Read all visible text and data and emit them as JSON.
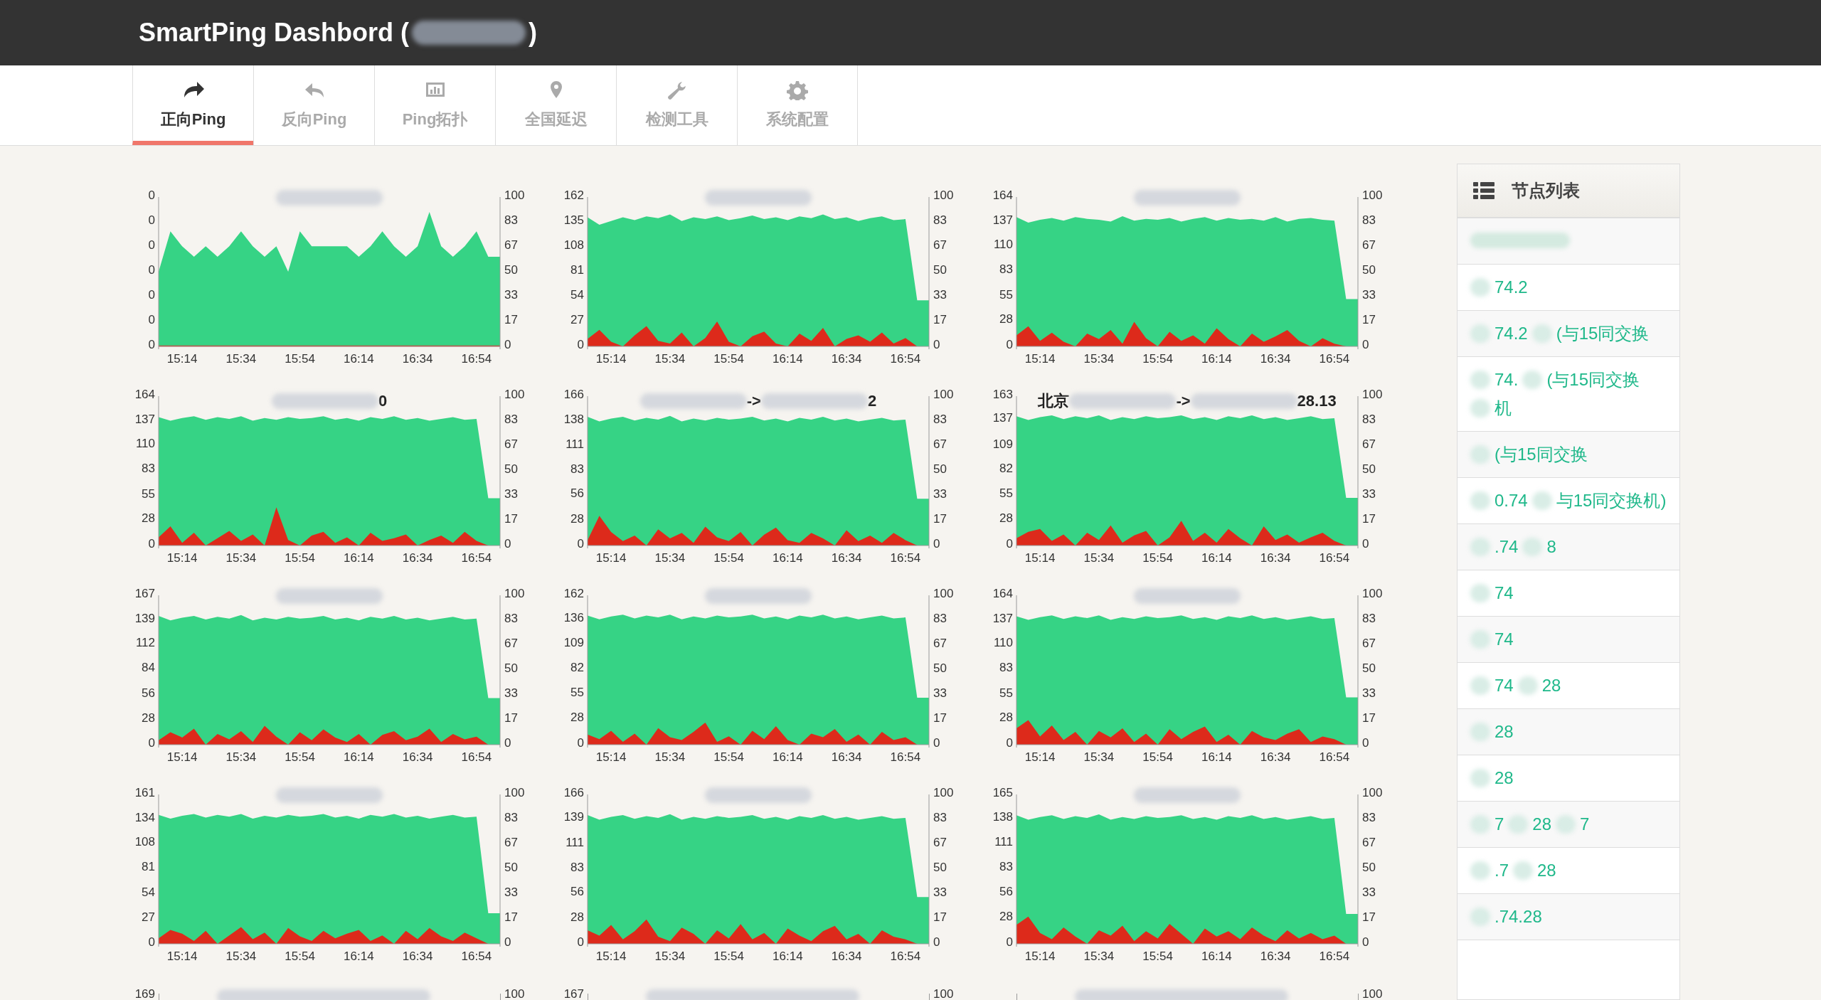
{
  "header": {
    "title_parts": [
      "SmartPing Dashbord (",
      ")"
    ]
  },
  "tabs": [
    {
      "label": "正向Ping",
      "selected": true
    },
    {
      "label": "反向Ping",
      "selected": false
    },
    {
      "label": "Ping拓扑",
      "selected": false
    },
    {
      "label": "全国延迟",
      "selected": false
    },
    {
      "label": "检测工具",
      "selected": false
    },
    {
      "label": "系统配置",
      "selected": false
    }
  ],
  "charts": [
    {
      "title_parts": [
        {
          "kind": "blur"
        }
      ],
      "left_tick_labels": [
        "0",
        "0",
        "0",
        "0",
        "0",
        "0",
        "0"
      ],
      "right_tick_labels": [
        "100",
        "83",
        "67",
        "50",
        "33",
        "17",
        "0"
      ],
      "x_tick_labels": [
        "15:14",
        "15:34",
        "15:54",
        "16:14",
        "16:34",
        "16:54"
      ]
    },
    {
      "title_parts": [
        {
          "kind": "blur"
        }
      ],
      "right_tick_labels": [
        "100",
        "83",
        "67",
        "50",
        "33",
        "17",
        "0"
      ],
      "chart_data": {
        "type": "area",
        "categories": [
          null,
          null,
          "15:14",
          null,
          null,
          null,
          null,
          "15:34",
          null,
          null,
          null,
          null,
          "15:54",
          null,
          null,
          null,
          null,
          "16:14",
          null,
          null,
          null,
          null,
          "16:34",
          null,
          null,
          null,
          null,
          "16:54",
          null,
          null
        ],
        "ylim": [
          0,
          162
        ],
        "yticks": [
          0,
          27,
          54,
          81,
          108,
          135,
          162
        ],
        "series": [
          {
            "color": "#36d385",
            "values": [
              140,
              132,
              136,
              140,
              137,
              141,
              139,
              143,
              136,
              140,
              138,
              141,
              137,
              139,
              142,
              138,
              140,
              137,
              141,
              139,
              143,
              138,
              140,
              136,
              139,
              141,
              137,
              138,
              50,
              50
            ]
          },
          {
            "color": "#dd2a1b",
            "values": [
              8,
              18,
              5,
              0,
              12,
              22,
              6,
              3,
              15,
              0,
              9,
              27,
              5,
              0,
              11,
              16,
              3,
              0,
              14,
              6,
              20,
              0,
              8,
              12,
              5,
              15,
              3,
              9,
              0,
              0
            ]
          }
        ]
      }
    },
    {
      "title_parts": [
        {
          "kind": "blur"
        }
      ],
      "right_tick_labels": [
        "100",
        "83",
        "67",
        "50",
        "33",
        "17",
        "0"
      ],
      "chart_data": {
        "type": "area",
        "categories": [
          null,
          null,
          "15:14",
          null,
          null,
          null,
          null,
          "15:34",
          null,
          null,
          null,
          null,
          "15:54",
          null,
          null,
          null,
          null,
          "16:14",
          null,
          null,
          null,
          null,
          "16:34",
          null,
          null,
          null,
          null,
          "16:54",
          null,
          null
        ],
        "ylim": [
          0,
          164
        ],
        "yticks": [
          0,
          28,
          55,
          83,
          110,
          137,
          164
        ],
        "series": [
          {
            "color": "#36d385",
            "values": [
              142,
              136,
              139,
              141,
              138,
              142,
              140,
              139,
              137,
              143,
              138,
              140,
              139,
              141,
              137,
              140,
              142,
              138,
              141,
              139,
              140,
              138,
              142,
              137,
              140,
              141,
              139,
              138,
              52,
              52
            ]
          },
          {
            "color": "#dd2a1b",
            "values": [
              12,
              22,
              6,
              15,
              5,
              0,
              14,
              8,
              18,
              3,
              27,
              9,
              0,
              16,
              6,
              12,
              3,
              20,
              8,
              0,
              14,
              5,
              11,
              18,
              6,
              0,
              9,
              3,
              0,
              0
            ]
          }
        ]
      }
    },
    {
      "title_parts": [
        {
          "kind": "blur"
        },
        {
          "kind": "text",
          "text": "0"
        }
      ],
      "right_tick_labels": [
        "100",
        "83",
        "67",
        "50",
        "33",
        "17",
        "0"
      ],
      "chart_data": {
        "type": "area",
        "categories": [
          null,
          null,
          "15:14",
          null,
          null,
          null,
          null,
          "15:34",
          null,
          null,
          null,
          null,
          "15:54",
          null,
          null,
          null,
          null,
          "16:14",
          null,
          null,
          null,
          null,
          "16:34",
          null,
          null,
          null,
          null,
          "16:54",
          null,
          null
        ],
        "ylim": [
          0,
          164
        ],
        "yticks": [
          0,
          28,
          55,
          83,
          110,
          137,
          164
        ],
        "series": [
          {
            "color": "#36d385",
            "values": [
              141,
              137,
              140,
              142,
              138,
              141,
              139,
              142,
              137,
              140,
              138,
              141,
              139,
              140,
              142,
              138,
              140,
              137,
              141,
              139,
              142,
              138,
              140,
              137,
              139,
              141,
              138,
              139,
              52,
              52
            ]
          },
          {
            "color": "#dd2a1b",
            "values": [
              9,
              21,
              3,
              14,
              0,
              8,
              16,
              5,
              12,
              0,
              42,
              6,
              0,
              11,
              15,
              3,
              9,
              0,
              14,
              5,
              8,
              12,
              0,
              6,
              11,
              3,
              15,
              5,
              0,
              0
            ]
          }
        ]
      }
    },
    {
      "title_parts": [
        {
          "kind": "blur"
        },
        {
          "kind": "text",
          "text": "->"
        },
        {
          "kind": "blur"
        },
        {
          "kind": "text",
          "text": "2"
        }
      ],
      "right_tick_labels": [
        "100",
        "83",
        "67",
        "50",
        "33",
        "17",
        "0"
      ],
      "chart_data": {
        "type": "area",
        "categories": [
          null,
          null,
          "15:14",
          null,
          null,
          null,
          null,
          "15:34",
          null,
          null,
          null,
          null,
          "15:54",
          null,
          null,
          null,
          null,
          "16:14",
          null,
          null,
          null,
          null,
          "16:34",
          null,
          null,
          null,
          null,
          "16:54",
          null,
          null
        ],
        "ylim": [
          0,
          166
        ],
        "yticks": [
          0,
          28,
          56,
          83,
          111,
          138,
          166
        ],
        "series": [
          {
            "color": "#36d385",
            "values": [
              143,
              138,
              141,
              143,
              139,
              142,
              140,
              144,
              138,
              141,
              139,
              142,
              140,
              141,
              143,
              139,
              141,
              138,
              142,
              140,
              143,
              139,
              141,
              138,
              140,
              142,
              139,
              140,
              52,
              52
            ]
          },
          {
            "color": "#dd2a1b",
            "values": [
              6,
              33,
              15,
              5,
              11,
              0,
              18,
              8,
              14,
              3,
              21,
              9,
              5,
              15,
              0,
              12,
              20,
              6,
              3,
              14,
              8,
              0,
              17,
              5,
              11,
              3,
              14,
              6,
              0,
              0
            ]
          }
        ]
      }
    },
    {
      "title_parts": [
        {
          "kind": "text",
          "text": "北京"
        },
        {
          "kind": "blur"
        },
        {
          "kind": "text",
          "text": "->"
        },
        {
          "kind": "blur"
        },
        {
          "kind": "text",
          "text": "28.13"
        }
      ],
      "right_tick_labels": [
        "100",
        "83",
        "67",
        "50",
        "33",
        "17",
        "0"
      ],
      "chart_data": {
        "type": "area",
        "categories": [
          null,
          null,
          "15:14",
          null,
          null,
          null,
          null,
          "15:34",
          null,
          null,
          null,
          null,
          "15:54",
          null,
          null,
          null,
          null,
          "16:14",
          null,
          null,
          null,
          null,
          "16:34",
          null,
          null,
          null,
          null,
          "16:54",
          null,
          null
        ],
        "ylim": [
          0,
          163
        ],
        "yticks": [
          0,
          28,
          55,
          82,
          109,
          137,
          163
        ],
        "series": [
          {
            "color": "#36d385",
            "values": [
              141,
              137,
              140,
              142,
              138,
              141,
              139,
              142,
              137,
              140,
              138,
              141,
              139,
              140,
              142,
              138,
              140,
              137,
              141,
              139,
              142,
              138,
              140,
              137,
              139,
              141,
              138,
              139,
              52,
              52
            ]
          },
          {
            "color": "#dd2a1b",
            "values": [
              8,
              15,
              18,
              5,
              12,
              0,
              14,
              6,
              22,
              3,
              11,
              16,
              0,
              9,
              27,
              5,
              14,
              3,
              18,
              8,
              0,
              21,
              6,
              12,
              3,
              9,
              14,
              5,
              0,
              0
            ]
          }
        ]
      }
    },
    {
      "title_parts": [
        {
          "kind": "blur"
        }
      ],
      "right_tick_labels": [
        "100",
        "83",
        "67",
        "50",
        "33",
        "17",
        "0"
      ],
      "chart_data": {
        "type": "area",
        "categories": [
          null,
          null,
          "15:14",
          null,
          null,
          null,
          null,
          "15:34",
          null,
          null,
          null,
          null,
          "15:54",
          null,
          null,
          null,
          null,
          "16:14",
          null,
          null,
          null,
          null,
          "16:34",
          null,
          null,
          null,
          null,
          "16:54",
          null,
          null
        ],
        "ylim": [
          0,
          167
        ],
        "yticks": [
          0,
          28,
          56,
          84,
          112,
          139,
          167
        ],
        "series": [
          {
            "color": "#36d385",
            "values": [
              144,
              139,
              142,
              144,
              140,
              143,
              141,
              145,
              139,
              142,
              140,
              143,
              141,
              142,
              144,
              140,
              142,
              139,
              143,
              141,
              144,
              140,
              142,
              139,
              141,
              143,
              140,
              141,
              52,
              52
            ]
          },
          {
            "color": "#dd2a1b",
            "values": [
              5,
              14,
              8,
              18,
              0,
              12,
              6,
              15,
              3,
              21,
              9,
              0,
              14,
              5,
              17,
              8,
              3,
              12,
              0,
              11,
              15,
              5,
              9,
              18,
              3,
              12,
              6,
              9,
              0,
              0
            ]
          }
        ]
      }
    },
    {
      "title_parts": [
        {
          "kind": "blur"
        }
      ],
      "right_tick_labels": [
        "100",
        "83",
        "67",
        "50",
        "33",
        "17",
        "0"
      ],
      "chart_data": {
        "type": "area",
        "categories": [
          null,
          null,
          "15:14",
          null,
          null,
          null,
          null,
          "15:34",
          null,
          null,
          null,
          null,
          "15:54",
          null,
          null,
          null,
          null,
          "16:14",
          null,
          null,
          null,
          null,
          "16:34",
          null,
          null,
          null,
          null,
          "16:54",
          null,
          null
        ],
        "ylim": [
          0,
          162
        ],
        "yticks": [
          0,
          28,
          55,
          82,
          109,
          136,
          162
        ],
        "series": [
          {
            "color": "#36d385",
            "values": [
              140,
              136,
              139,
              141,
              137,
              140,
              138,
              141,
              136,
              139,
              137,
              140,
              138,
              139,
              141,
              137,
              139,
              136,
              140,
              138,
              141,
              137,
              139,
              136,
              138,
              140,
              137,
              138,
              51,
              51
            ]
          },
          {
            "color": "#dd2a1b",
            "values": [
              11,
              6,
              15,
              3,
              12,
              0,
              18,
              8,
              5,
              14,
              24,
              3,
              9,
              0,
              15,
              6,
              20,
              5,
              0,
              12,
              8,
              17,
              3,
              11,
              0,
              14,
              5,
              8,
              0,
              0
            ]
          }
        ]
      }
    },
    {
      "title_parts": [
        {
          "kind": "blur"
        }
      ],
      "right_tick_labels": [
        "100",
        "83",
        "67",
        "50",
        "33",
        "17",
        "0"
      ],
      "chart_data": {
        "type": "area",
        "categories": [
          null,
          null,
          "15:14",
          null,
          null,
          null,
          null,
          "15:34",
          null,
          null,
          null,
          null,
          "15:54",
          null,
          null,
          null,
          null,
          "16:14",
          null,
          null,
          null,
          null,
          "16:34",
          null,
          null,
          null,
          null,
          "16:54",
          null,
          null
        ],
        "ylim": [
          0,
          164
        ],
        "yticks": [
          0,
          28,
          55,
          83,
          110,
          137,
          164
        ],
        "series": [
          {
            "color": "#36d385",
            "values": [
              141,
              137,
              140,
              142,
              138,
              141,
              139,
              142,
              137,
              140,
              138,
              141,
              139,
              140,
              142,
              138,
              140,
              137,
              141,
              139,
              142,
              138,
              140,
              137,
              139,
              141,
              138,
              139,
              52,
              52
            ]
          },
          {
            "color": "#dd2a1b",
            "values": [
              18,
              27,
              9,
              21,
              5,
              14,
              0,
              15,
              8,
              18,
              3,
              12,
              0,
              17,
              6,
              14,
              20,
              3,
              11,
              0,
              15,
              8,
              5,
              12,
              17,
              3,
              9,
              6,
              0,
              0
            ]
          }
        ]
      }
    },
    {
      "title_parts": [
        {
          "kind": "blur"
        }
      ],
      "right_tick_labels": [
        "100",
        "83",
        "67",
        "50",
        "33",
        "17",
        "0"
      ],
      "chart_data": {
        "type": "area",
        "categories": [
          null,
          null,
          "15:14",
          null,
          null,
          null,
          null,
          "15:34",
          null,
          null,
          null,
          null,
          "15:54",
          null,
          null,
          null,
          null,
          "16:14",
          null,
          null,
          null,
          null,
          "16:34",
          null,
          null,
          null,
          null,
          "16:54",
          null,
          null
        ],
        "ylim": [
          0,
          161
        ],
        "yticks": [
          0,
          27,
          54,
          81,
          108,
          134,
          161
        ],
        "series": [
          {
            "color": "#36d385",
            "values": [
              139,
              135,
              138,
              140,
              136,
              139,
              137,
              140,
              135,
              138,
              136,
              139,
              137,
              138,
              140,
              136,
              138,
              135,
              139,
              137,
              140,
              136,
              138,
              135,
              137,
              139,
              136,
              137,
              33,
              33
            ]
          },
          {
            "color": "#dd2a1b",
            "values": [
              6,
              15,
              11,
              3,
              14,
              0,
              9,
              18,
              5,
              12,
              0,
              17,
              8,
              3,
              14,
              6,
              11,
              15,
              3,
              9,
              0,
              14,
              5,
              17,
              8,
              3,
              12,
              6,
              0,
              0
            ]
          }
        ]
      }
    },
    {
      "title_parts": [
        {
          "kind": "blur"
        }
      ],
      "right_tick_labels": [
        "100",
        "83",
        "67",
        "50",
        "33",
        "17",
        "0"
      ],
      "chart_data": {
        "type": "area",
        "categories": [
          null,
          null,
          "15:14",
          null,
          null,
          null,
          null,
          "15:34",
          null,
          null,
          null,
          null,
          "15:54",
          null,
          null,
          null,
          null,
          "16:14",
          null,
          null,
          null,
          null,
          "16:34",
          null,
          null,
          null,
          null,
          "16:54",
          null,
          null
        ],
        "ylim": [
          0,
          166
        ],
        "yticks": [
          0,
          28,
          56,
          83,
          111,
          139,
          166
        ],
        "series": [
          {
            "color": "#36d385",
            "values": [
              143,
              138,
              141,
              143,
              139,
              142,
              140,
              144,
              138,
              141,
              139,
              142,
              140,
              141,
              143,
              139,
              141,
              138,
              142,
              140,
              143,
              139,
              141,
              138,
              140,
              142,
              139,
              140,
              52,
              52
            ]
          },
          {
            "color": "#dd2a1b",
            "values": [
              15,
              9,
              21,
              5,
              14,
              27,
              8,
              3,
              18,
              11,
              0,
              15,
              6,
              22,
              5,
              12,
              0,
              17,
              9,
              3,
              14,
              20,
              5,
              11,
              0,
              15,
              8,
              5,
              0,
              0
            ]
          }
        ]
      }
    },
    {
      "title_parts": [
        {
          "kind": "blur"
        }
      ],
      "right_tick_labels": [
        "100",
        "83",
        "67",
        "50",
        "33",
        "17",
        "0"
      ],
      "chart_data": {
        "type": "area",
        "categories": [
          null,
          null,
          "15:14",
          null,
          null,
          null,
          null,
          "15:34",
          null,
          null,
          null,
          null,
          "15:54",
          null,
          null,
          null,
          null,
          "16:14",
          null,
          null,
          null,
          null,
          "16:34",
          null,
          null,
          null,
          null,
          "16:54",
          null,
          null
        ],
        "ylim": [
          0,
          165
        ],
        "yticks": [
          0,
          28,
          56,
          83,
          111,
          138,
          165
        ],
        "series": [
          {
            "color": "#36d385",
            "values": [
              142,
              137,
              140,
              142,
              138,
              141,
              139,
              143,
              137,
              140,
              138,
              141,
              139,
              140,
              142,
              138,
              140,
              137,
              141,
              139,
              142,
              138,
              140,
              137,
              139,
              141,
              138,
              139,
              33,
              33
            ]
          },
          {
            "color": "#dd2a1b",
            "values": [
              21,
              30,
              12,
              5,
              18,
              8,
              0,
              15,
              9,
              20,
              3,
              14,
              6,
              22,
              11,
              0,
              17,
              8,
              14,
              5,
              18,
              9,
              3,
              15,
              6,
              12,
              5,
              9,
              0,
              0
            ]
          }
        ]
      }
    }
  ],
  "partial_charts": [
    {
      "left_tick": "169",
      "right_tick": "100"
    },
    {
      "left_tick": "167",
      "right_tick": "100"
    },
    {
      "right_tick": "100"
    }
  ],
  "sidebar": {
    "title": "节点列表",
    "items": [
      {
        "kind": "blurred"
      },
      {
        "kind": "text",
        "lines": [
          [
            "74.2"
          ]
        ]
      },
      {
        "kind": "text",
        "lines": [
          [
            "74.2",
            "(与15同交换"
          ]
        ]
      },
      {
        "kind": "text",
        "lines": [
          [
            "74.",
            "(与15同交换"
          ],
          [
            "机"
          ]
        ]
      },
      {
        "kind": "text",
        "lines": [
          [
            "(与15同交换"
          ]
        ]
      },
      {
        "kind": "text",
        "lines": [
          [
            "0.74",
            "与15同交换机)"
          ]
        ]
      },
      {
        "kind": "text",
        "lines": [
          [
            ".74",
            "8"
          ]
        ]
      },
      {
        "kind": "text",
        "lines": [
          [
            "74"
          ]
        ]
      },
      {
        "kind": "text",
        "lines": [
          [
            "74"
          ]
        ]
      },
      {
        "kind": "text",
        "lines": [
          [
            "74",
            "28"
          ]
        ]
      },
      {
        "kind": "text",
        "lines": [
          [
            "28"
          ]
        ]
      },
      {
        "kind": "text",
        "lines": [
          [
            "28"
          ]
        ]
      },
      {
        "kind": "text",
        "lines": [
          [
            "7",
            "28",
            "7"
          ]
        ]
      },
      {
        "kind": "text",
        "lines": [
          [
            ".7",
            "28"
          ]
        ]
      },
      {
        "kind": "text",
        "lines": [
          [
            ".74.28"
          ]
        ]
      }
    ]
  }
}
